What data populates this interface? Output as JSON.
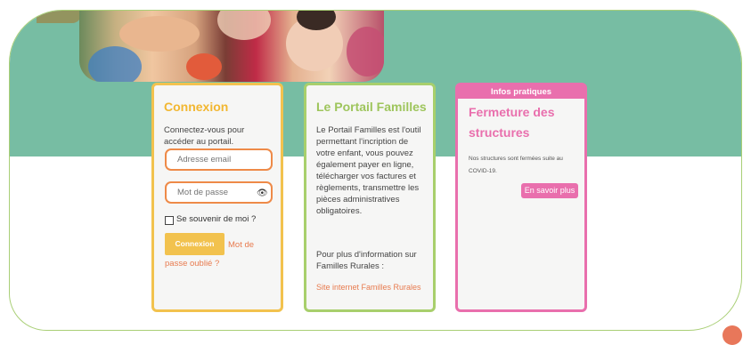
{
  "login": {
    "title": "Connexion",
    "intro": "Connectez-vous pour accéder au portail.",
    "email_placeholder": "Adresse email",
    "password_placeholder": "Mot de passe",
    "remember_label": "Se souvenir de moi ?",
    "submit_label": "Connexion",
    "forgot_line1": "Mot de",
    "forgot_line2": "passe oublié ?"
  },
  "portail": {
    "title": "Le Portail Familles",
    "description_lines": [
      "Le Portail Familles est l'outil",
      "permettant l'incription de",
      "votre enfant, vous pouvez",
      "également payer en ligne,",
      "télécharger vos factures et",
      "règlements, transmettre les",
      "pièces administratives",
      "obligatoires."
    ],
    "more_info_line1": "Pour plus d'information sur",
    "more_info_line2": "Familles Rurales :",
    "link_label": "Site internet Familles Rurales"
  },
  "infos": {
    "header": "Infos pratiques",
    "title": "Fermeture des structures",
    "text_line1": "Nos structures sont fermées suite au",
    "text_line2": "COVID-19.",
    "button_label": "En savoir plus"
  },
  "icons": {
    "password_toggle": "eye-icon",
    "remember_checkbox": "checkbox-icon"
  },
  "colors": {
    "banner_green": "#77bda3",
    "connexion_yellow": "#f2c24e",
    "portail_green": "#a8cf6c",
    "infos_pink": "#e96fad",
    "field_orange": "#ee8a48",
    "link_orange": "#e87b4f"
  }
}
